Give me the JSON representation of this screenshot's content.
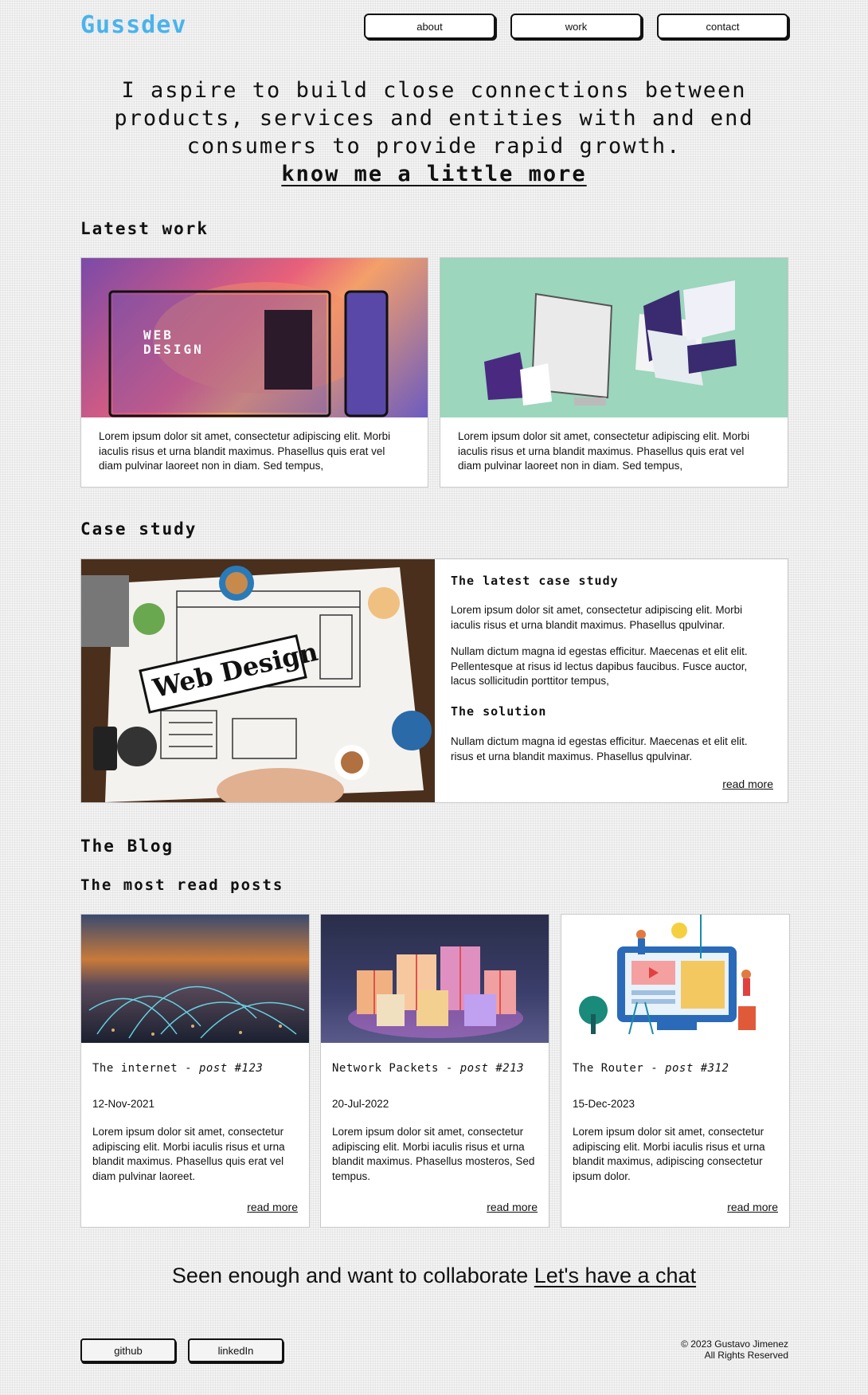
{
  "header": {
    "logo": "Gussdev",
    "nav": [
      {
        "label": "about"
      },
      {
        "label": "work"
      },
      {
        "label": "contact"
      }
    ]
  },
  "hero": {
    "line1": "I aspire to build close connections between",
    "line2": "products, services and entities with and end",
    "line3": "consumers to provide rapid growth.",
    "link": "know me a little more"
  },
  "latest_work": {
    "title": "Latest work",
    "cards": [
      {
        "image": "web-design-mockup",
        "img_text_a": "WEB",
        "img_text_b": "DESIGN",
        "text": "Lorem ipsum dolor sit amet, consectetur adipiscing elit. Morbi iaculis risus et urna blandit maximus. Phasellus quis erat vel diam pulvinar laoreet non in diam. Sed tempus,"
      },
      {
        "image": "devices-mockup",
        "text": "Lorem ipsum dolor sit amet, consectetur adipiscing elit. Morbi iaculis risus et urna blandit maximus. Phasellus quis erat vel diam pulvinar laoreet non in diam. Sed tempus,"
      }
    ]
  },
  "case_study": {
    "title": "Case study",
    "image_text": "Web Design",
    "heading1": "The latest case study",
    "p1": "Lorem ipsum dolor sit amet, consectetur adipiscing elit. Morbi iaculis risus et urna blandit maximus. Phasellus qpulvinar.",
    "p2": "Nullam dictum magna id egestas efficitur. Maecenas et elit elit. Pellentesque at risus id lectus dapibus faucibus. Fusce auctor, lacus sollicitudin porttitor tempus,",
    "heading2": "The solution",
    "p3": "Nullam dictum magna id egestas efficitur. Maecenas et elit elit. risus et urna blandit maximus. Phasellus qpulvinar.",
    "read_more": "read more"
  },
  "blog": {
    "title": "The Blog",
    "subtitle": "The most read posts",
    "posts": [
      {
        "title": "The internet - ",
        "post_no": "post #123",
        "date": "12-Nov-2021",
        "text": "Lorem ipsum dolor sit amet, consectetur adipiscing elit. Morbi iaculis risus et urna blandit maximus. Phasellus quis erat vel diam pulvinar laoreet.",
        "read_more": "read more"
      },
      {
        "title": "Network Packets - ",
        "post_no": "post #213",
        "date": "20-Jul-2022",
        "text": "Lorem ipsum dolor sit amet, consectetur adipiscing elit. Morbi iaculis risus et urna blandit maximus. Phasellus mosteros, Sed tempus.",
        "read_more": "read more"
      },
      {
        "title": "The Router - ",
        "post_no": "post #312",
        "date": "15-Dec-2023",
        "text": "Lorem ipsum dolor sit amet, consectetur adipiscing elit. Morbi iaculis risus et urna blandit maximus, adipiscing consectetur ipsum dolor.",
        "read_more": "read more"
      }
    ]
  },
  "cta": {
    "text": "Seen enough and want to collaborate ",
    "link": "Let's have a chat"
  },
  "footer": {
    "buttons": [
      {
        "label": "github"
      },
      {
        "label": "linkedIn"
      }
    ],
    "copyright": "© 2023 Gustavo Jimenez",
    "rights": "All Rights Reserved"
  },
  "colors": {
    "logo": "#4ab3ec",
    "text": "#111111",
    "card_border": "#c8c8c8"
  }
}
